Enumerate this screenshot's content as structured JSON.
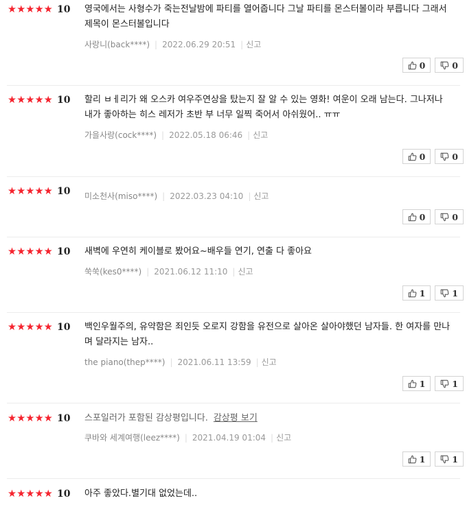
{
  "reviews": [
    {
      "stars": "★★★★★",
      "score": "10",
      "text": "영국에서는 사형수가 죽는전날밤에 파티를 열어줍니다 그날 파티를 몬스터볼이라 부릅니다 그래서 제목이 몬스터볼입니다",
      "user": "사랑니(back****)",
      "date": "2022.06.29 20:51",
      "report": "신고",
      "likes": "0",
      "dislikes": "0"
    },
    {
      "stars": "★★★★★",
      "score": "10",
      "text": "할리 ㅂㅔ리가 왜 오스카 여우주연상을 탔는지 잘 알 수 있는 영화! 여운이 오래 남는다. 그나저나 내가 좋아하는 히스 레저가 초반 부 너무 일찍 죽어서 아쉬웠어.. ㅠㅠ",
      "user": "가을사랑(cock****)",
      "date": "2022.05.18 06:46",
      "report": "신고",
      "likes": "0",
      "dislikes": "0"
    },
    {
      "stars": "★★★★★",
      "score": "10",
      "text": "",
      "user": "미소천사(miso****)",
      "date": "2022.03.23 04:10",
      "report": "신고",
      "likes": "0",
      "dislikes": "0"
    },
    {
      "stars": "★★★★★",
      "score": "10",
      "text": "새벽에 우연히 케이블로 봤어요~배우들 연기, 연출 다 좋아요",
      "user": "쑥쑥(kes0****)",
      "date": "2021.06.12 11:10",
      "report": "신고",
      "likes": "1",
      "dislikes": "1"
    },
    {
      "stars": "★★★★★",
      "score": "10",
      "text": "백인우월주의, 유약함은 죄인듯 오로지 강함을 유전으로 살아온 살아야했던 남자들. 한 여자를 만나며 달라지는 남자..",
      "user": "the piano(thep****)",
      "date": "2021.06.11 13:59",
      "report": "신고",
      "likes": "1",
      "dislikes": "1"
    },
    {
      "stars": "★★★★★",
      "score": "10",
      "text": "스포일러가 포함된 감상평입니다.",
      "spoiler_link": "감상평 보기",
      "user": "쿠바와 세계여행(leez****)",
      "date": "2021.04.19 01:04",
      "report": "신고",
      "likes": "1",
      "dislikes": "1"
    },
    {
      "stars": "★★★★★",
      "score": "10",
      "text": "아주 좋았다.별기대 없었는데.."
    }
  ],
  "icons": {
    "like": "thumbs-up-icon",
    "dislike": "thumbs-down-icon"
  },
  "colors": {
    "star": "#f5242f"
  }
}
